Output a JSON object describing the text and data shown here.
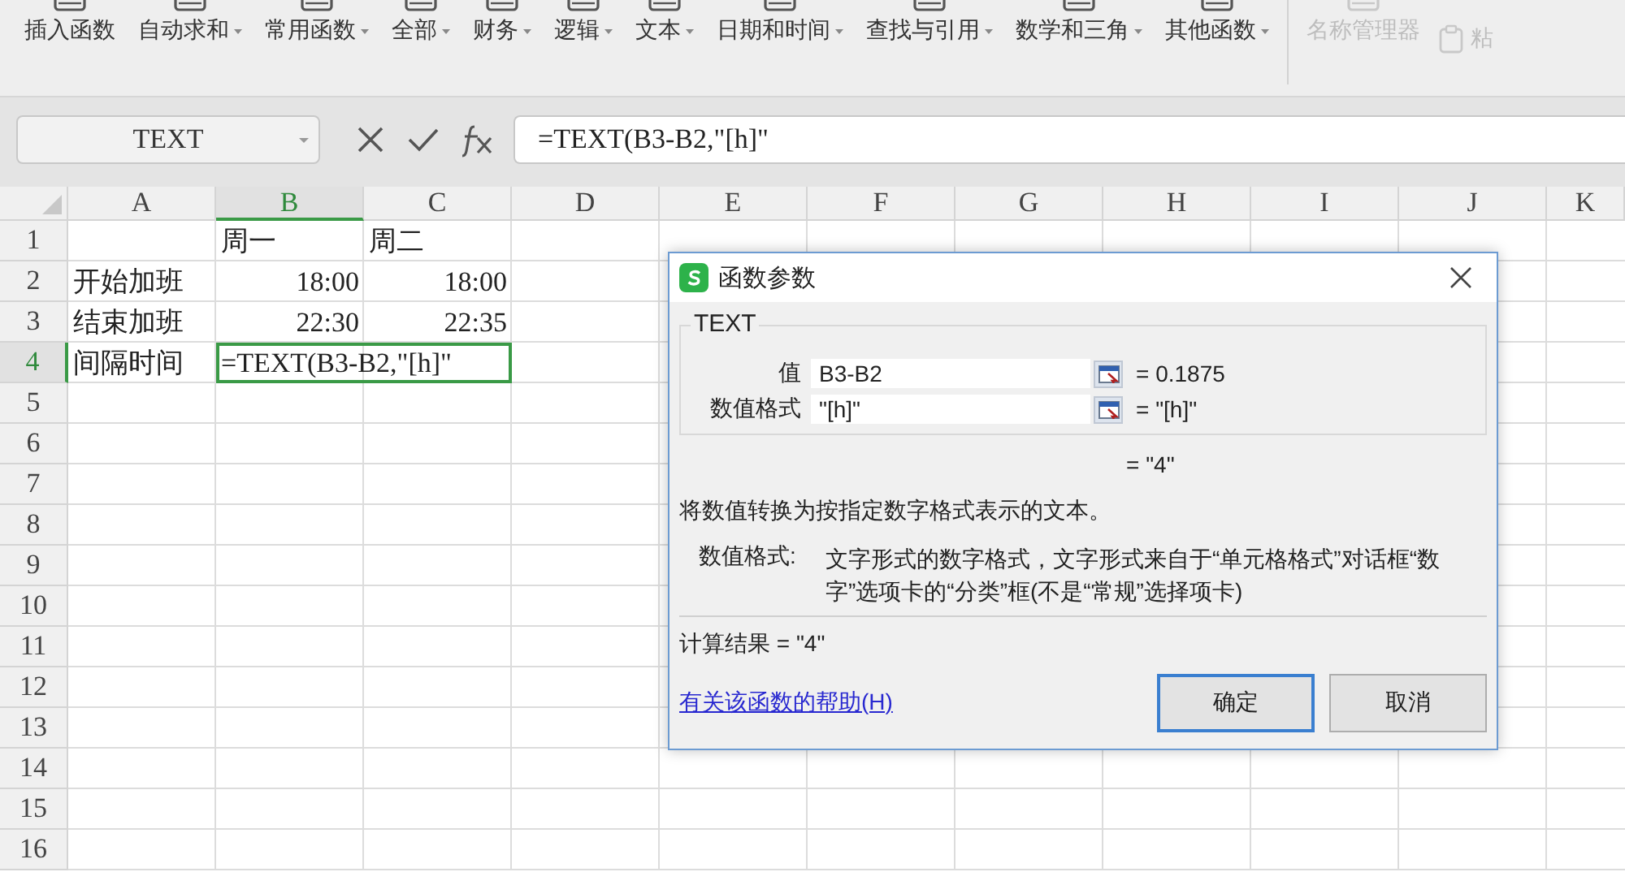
{
  "ribbon": {
    "items": [
      {
        "label": "插入函数",
        "kind": "large",
        "dropdown": false,
        "disabled": false
      },
      {
        "label": "自动求和",
        "kind": "large",
        "dropdown": true,
        "disabled": false
      },
      {
        "label": "常用函数",
        "kind": "large",
        "dropdown": true,
        "disabled": false
      },
      {
        "label": "全部",
        "kind": "large",
        "dropdown": true,
        "disabled": false
      },
      {
        "label": "财务",
        "kind": "large",
        "dropdown": true,
        "disabled": false
      },
      {
        "label": "逻辑",
        "kind": "large",
        "dropdown": true,
        "disabled": false
      },
      {
        "label": "文本",
        "kind": "large",
        "dropdown": true,
        "disabled": false
      },
      {
        "label": "日期和时间",
        "kind": "large",
        "dropdown": true,
        "disabled": false
      },
      {
        "label": "查找与引用",
        "kind": "large",
        "dropdown": true,
        "disabled": false
      },
      {
        "label": "数学和三角",
        "kind": "large",
        "dropdown": true,
        "disabled": false
      },
      {
        "label": "其他函数",
        "kind": "large",
        "dropdown": true,
        "disabled": false
      },
      {
        "label": "名称管理器",
        "kind": "large",
        "dropdown": false,
        "disabled": true
      },
      {
        "label": "粘",
        "kind": "small",
        "dropdown": false,
        "disabled": true
      }
    ]
  },
  "formula_bar": {
    "name_box": "TEXT",
    "formula": "=TEXT(B3-B2,\"[h]\""
  },
  "sheet": {
    "columns": [
      {
        "label": "A",
        "selected": false
      },
      {
        "label": "B",
        "selected": true
      },
      {
        "label": "C",
        "selected": false
      },
      {
        "label": "D",
        "selected": false
      },
      {
        "label": "E",
        "selected": false
      },
      {
        "label": "F",
        "selected": false
      },
      {
        "label": "G",
        "selected": false
      },
      {
        "label": "H",
        "selected": false
      },
      {
        "label": "I",
        "selected": false
      },
      {
        "label": "J",
        "selected": false
      },
      {
        "label": "K",
        "selected": false
      }
    ],
    "rows": [
      {
        "label": "1",
        "selected": false,
        "cells": [
          null,
          {
            "text": "周一",
            "kind": "text",
            "active": false
          },
          {
            "text": "周二",
            "kind": "text",
            "active": false
          }
        ]
      },
      {
        "label": "2",
        "selected": false,
        "cells": [
          {
            "text": "开始加班",
            "kind": "text",
            "active": false
          },
          {
            "text": "18:00",
            "kind": "time",
            "active": false
          },
          {
            "text": "18:00",
            "kind": "time",
            "active": false
          }
        ]
      },
      {
        "label": "3",
        "selected": false,
        "cells": [
          {
            "text": "结束加班",
            "kind": "text",
            "active": false
          },
          {
            "text": "22:30",
            "kind": "time",
            "active": false
          },
          {
            "text": "22:35",
            "kind": "time",
            "active": false
          }
        ]
      },
      {
        "label": "4",
        "selected": true,
        "cells": [
          {
            "text": "间隔时间",
            "kind": "text",
            "active": false
          },
          {
            "text": "=TEXT(B3-B2,\"[h]\"",
            "kind": "text",
            "active": true
          }
        ]
      },
      {
        "label": "5",
        "selected": false
      },
      {
        "label": "6",
        "selected": false
      },
      {
        "label": "7",
        "selected": false
      },
      {
        "label": "8",
        "selected": false
      },
      {
        "label": "9",
        "selected": false
      },
      {
        "label": "10",
        "selected": false
      },
      {
        "label": "11",
        "selected": false
      },
      {
        "label": "12",
        "selected": false
      },
      {
        "label": "13",
        "selected": false
      },
      {
        "label": "14",
        "selected": false
      },
      {
        "label": "15",
        "selected": false
      },
      {
        "label": "16",
        "selected": false
      }
    ]
  },
  "dialog": {
    "title": "函数参数",
    "function_name": "TEXT",
    "arguments": [
      {
        "label": "值",
        "value": "B3-B2",
        "result": "= 0.1875"
      },
      {
        "label": "数值格式",
        "value": "\"[h]\"",
        "result": "= \"[h]\""
      }
    ],
    "result": "= \"4\"",
    "description": "将数值转换为按指定数字格式表示的文本。",
    "argument_help_label": "数值格式:",
    "argument_help_text": "文字形式的数字格式，文字形式来自于“单元格格式”对话框“数字”选项卡的“分类”框(不是“常规”选择项卡)",
    "calculation_result": "计算结果 = \"4\"",
    "help_link": "有关该函数的帮助(H)",
    "buttons": [
      {
        "label": "确定",
        "default": true
      },
      {
        "label": "取消",
        "default": false
      }
    ]
  }
}
